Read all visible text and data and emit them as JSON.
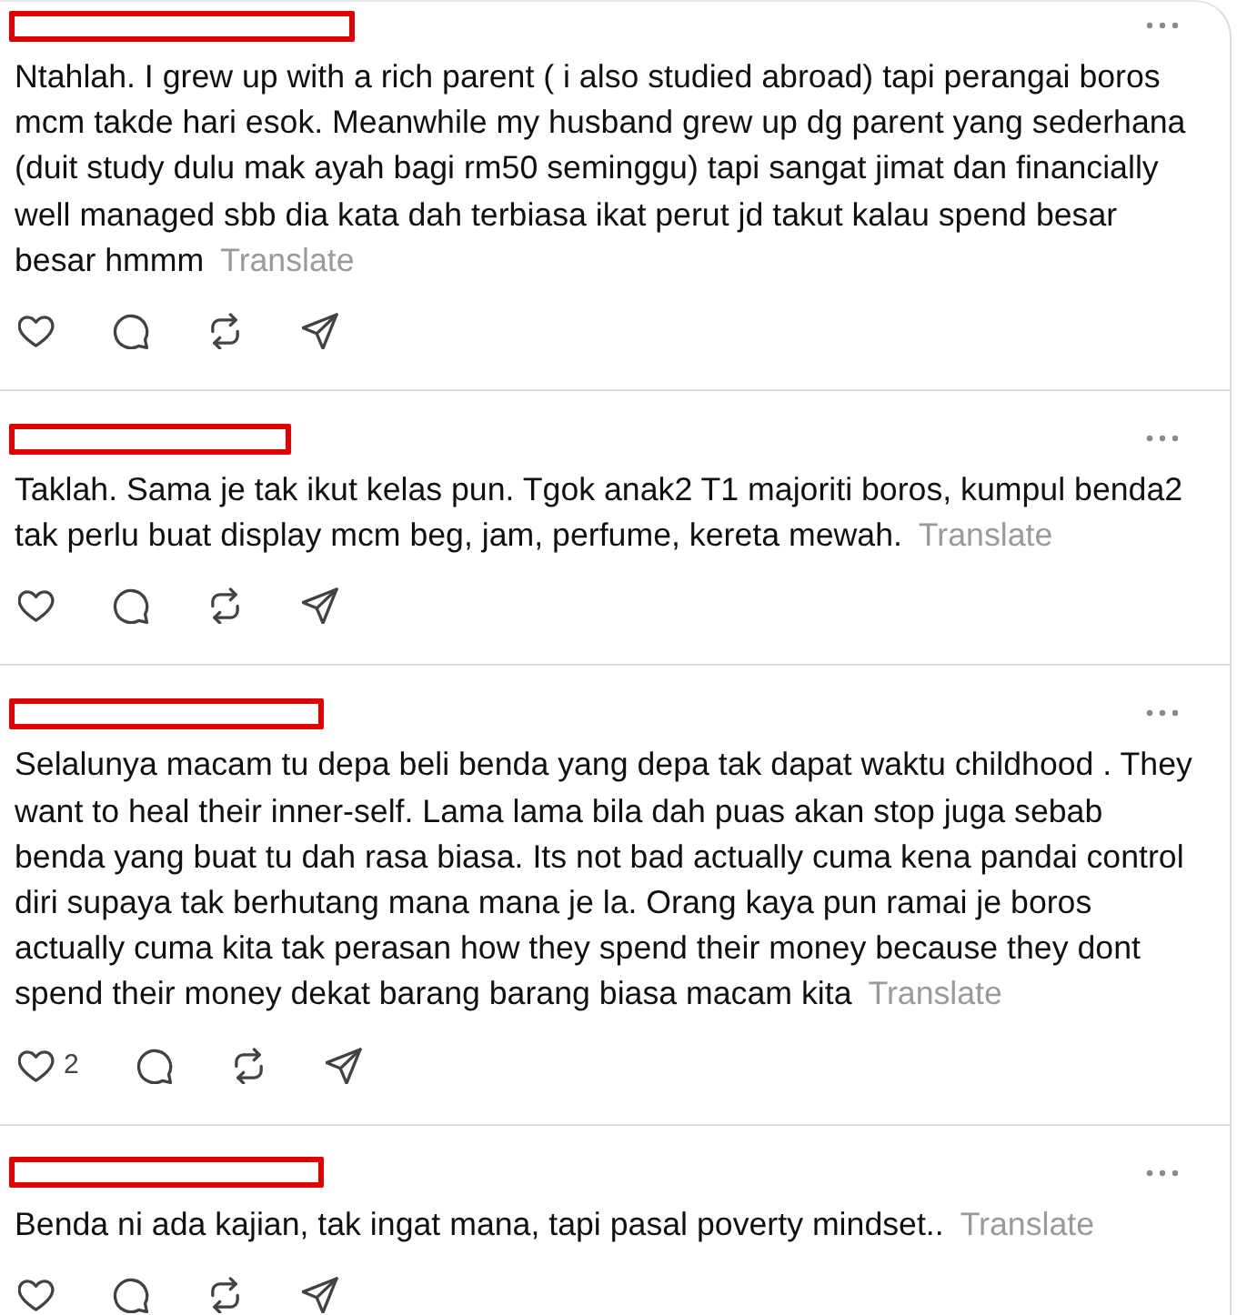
{
  "comments": [
    {
      "redacted": true,
      "text": "Ntahlah. I grew up with a rich parent ( i also studied abroad) tapi perangai boros mcm takde hari esok. Meanwhile my husband grew up dg parent yang sederhana (duit study dulu mak ayah bagi rm50 seminggu) tapi sangat jimat dan financially well managed sbb dia kata dah terbiasa ikat perut jd takut kalau spend besar besar hmmm",
      "translate": "Translate"
    },
    {
      "redacted": true,
      "text": "Taklah. Sama je tak ikut kelas pun. Tgok anak2 T1 majoriti boros, kumpul benda2 tak perlu buat display mcm beg, jam, perfume, kereta mewah.",
      "translate": "Translate"
    },
    {
      "redacted": true,
      "text": "Selalunya macam tu depa beli benda yang depa tak dapat waktu childhood . They want to heal their inner-self. Lama lama bila dah puas akan stop juga sebab benda yang buat tu dah rasa biasa. Its not bad actually cuma kena pandai control diri supaya tak berhutang mana mana je la. Orang kaya pun ramai je boros actually cuma kita tak perasan how they spend their money because they dont spend their money dekat barang barang biasa macam kita",
      "translate": "Translate",
      "like_count": "2"
    },
    {
      "redacted": true,
      "text": "Benda ni ada kajian, tak ingat mana, tapi pasal poverty mindset..",
      "translate": "Translate"
    }
  ]
}
